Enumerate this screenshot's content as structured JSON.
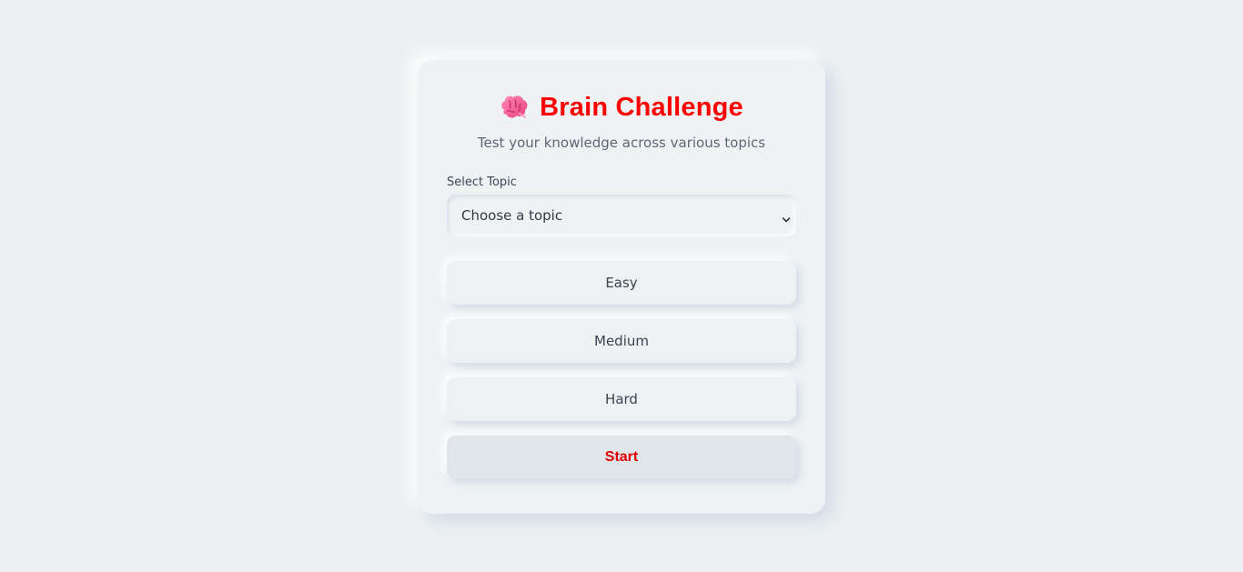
{
  "app": {
    "title": "Brain Challenge",
    "subtitle": "Test your knowledge across various topics",
    "title_icon": "brain-icon"
  },
  "topic": {
    "label": "Select Topic",
    "selected": "Choose a topic"
  },
  "difficulty": {
    "options": [
      "Easy",
      "Medium",
      "Hard"
    ]
  },
  "actions": {
    "start_label": "Start"
  },
  "colors": {
    "accent": "#ff0000",
    "background": "#ecf0f1",
    "text": "#3c4350"
  }
}
